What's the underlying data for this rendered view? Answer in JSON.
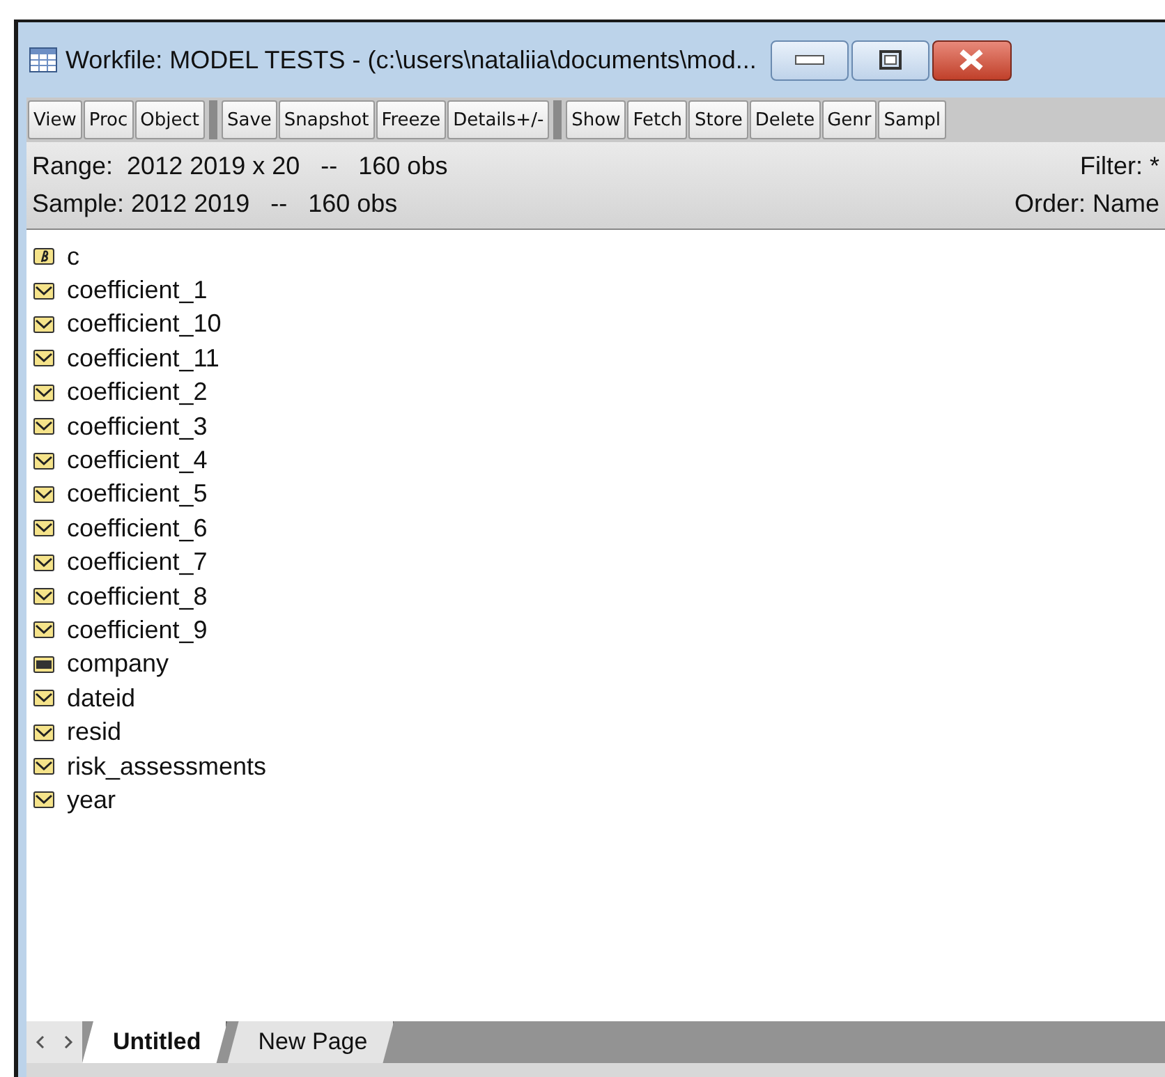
{
  "window": {
    "title": "Workfile: MODEL TESTS - (c:\\users\\nataliia\\documents\\mod..."
  },
  "toolbar": [
    [
      "View",
      "Proc",
      "Object"
    ],
    [
      "Save",
      "Snapshot",
      "Freeze",
      "Details+/-"
    ],
    [
      "Show",
      "Fetch",
      "Store",
      "Delete",
      "Genr",
      "Sampl"
    ]
  ],
  "info": {
    "range": "Range:  2012 2019 x 20   --   160 obs",
    "filter": "Filter: *",
    "sample": "Sample: 2012 2019   --   160 obs",
    "order": "Order: Name"
  },
  "objects": [
    {
      "name": "c",
      "kind": "coef"
    },
    {
      "name": "coefficient_1",
      "kind": "series"
    },
    {
      "name": "coefficient_10",
      "kind": "series"
    },
    {
      "name": "coefficient_11",
      "kind": "series"
    },
    {
      "name": "coefficient_2",
      "kind": "series"
    },
    {
      "name": "coefficient_3",
      "kind": "series"
    },
    {
      "name": "coefficient_4",
      "kind": "series"
    },
    {
      "name": "coefficient_5",
      "kind": "series"
    },
    {
      "name": "coefficient_6",
      "kind": "series"
    },
    {
      "name": "coefficient_7",
      "kind": "series"
    },
    {
      "name": "coefficient_8",
      "kind": "series"
    },
    {
      "name": "coefficient_9",
      "kind": "series"
    },
    {
      "name": "company",
      "kind": "alpha"
    },
    {
      "name": "dateid",
      "kind": "series"
    },
    {
      "name": "resid",
      "kind": "series"
    },
    {
      "name": "risk_assessments",
      "kind": "series"
    },
    {
      "name": "year",
      "kind": "series"
    }
  ],
  "page_tabs": [
    {
      "label": "Untitled",
      "selected": true
    },
    {
      "label": "New Page",
      "selected": false
    }
  ]
}
